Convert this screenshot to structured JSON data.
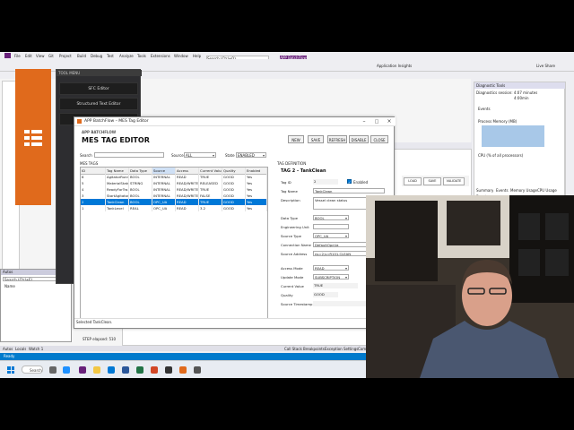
{
  "ide": {
    "menu": [
      "File",
      "Edit",
      "View",
      "Git",
      "Project",
      "Build",
      "Debug",
      "Test",
      "Analyze",
      "Tools",
      "Extensions",
      "Window",
      "Help"
    ],
    "search_placeholder": "Search (Ctrl+Q)",
    "brand_text": "APP BatchFlow",
    "live_share": "Live Share",
    "app_insights": "Application Insights",
    "designer_headers": [
      "Description",
      "Revision",
      "Status"
    ],
    "selected_label": "SELECTED",
    "autos_title": "Autos",
    "autos_search": "Search (Ctrl+E)",
    "autos_col": "Name",
    "bottom_tabs": [
      "Autos",
      "Locals",
      "Watch 1"
    ],
    "bottom_tabs_right": [
      "Call Stack",
      "Breakpoints",
      "Exception Settings",
      "Command Window",
      "Immediate Window",
      "Output"
    ],
    "status": "Ready",
    "step_elapsed": "STEP elapsed: 510"
  },
  "sfc_menu": {
    "title": "TOOL MENU",
    "items": [
      "SFC Editor",
      "Structured Text Editor"
    ]
  },
  "diagnostics": {
    "title": "Diagnostic Tools",
    "session": "Diagnostics session: 4:07 minutes",
    "timeline": "4:00min",
    "events": "Events",
    "process_memory": "Process Memory (MB)",
    "cpu": "CPU (% of all processors)",
    "tabs": [
      "Summary",
      "Events",
      "Memory Usage",
      "CPU Usage"
    ],
    "events2": "Events",
    "show_events": "Show Events (0 of 0)",
    "memory_usage": "Memory Usage",
    "take_snapshot": "Take Snapshot"
  },
  "background_panel": {
    "buttons": [
      "LOAD",
      "SAVE",
      "VALIDATE"
    ],
    "element_label": "SFC ELEMENT",
    "step_label": "STEP",
    "step_value": "S10",
    "num_value": "20",
    "design_label": "DESIGN",
    "start_label": "START"
  },
  "mes": {
    "window_title": "APP BatchFlow – MES Tag Editor",
    "app_label": "APP BATCHFLOW",
    "heading": "MES TAG EDITOR",
    "buttons": [
      "NEW",
      "SAVE",
      "REFRESH",
      "DISABLE",
      "CLOSE"
    ],
    "search_label": "Search",
    "source_label": "Source",
    "source_value": "ALL",
    "state_label": "State",
    "state_value": "ENABLED",
    "tags_label": "MES TAGS",
    "columns": [
      "ID",
      "Tag Name",
      "Data Type",
      "Source",
      "Access",
      "Current Value",
      "Quality",
      "Enabled"
    ],
    "rows": [
      [
        "6",
        "AgitatorRunn...",
        "BOOL",
        "INTERNAL",
        "READ",
        "TRUE",
        "GOOD",
        "Yes"
      ],
      [
        "5",
        "MaterialStatus",
        "STRING",
        "INTERNAL",
        "READ/WRITE",
        "RELEASED",
        "GOOD",
        "Yes"
      ],
      [
        "4",
        "ReadyForTra...",
        "BOOL",
        "INTERNAL",
        "READ/WRITE",
        "TRUE",
        "GOOD",
        "Yes"
      ],
      [
        "3",
        "StartAgitator",
        "BOOL",
        "INTERNAL",
        "READ/WRITE",
        "FALSE",
        "GOOD",
        "Yes"
      ],
      [
        "2",
        "TankClean",
        "BOOL",
        "OPC_UA",
        "READ",
        "TRUE",
        "GOOD",
        "Yes"
      ],
      [
        "1",
        "TankLevel",
        "REAL",
        "OPC_UA",
        "READ",
        "3.2",
        "GOOD",
        "Yes"
      ]
    ],
    "selected_row": 4,
    "definition_label": "TAG DEFINITION",
    "definition_title": "TAG 2 - TankClean",
    "fields": {
      "tag_id_label": "Tag ID",
      "tag_id": "2",
      "enabled_label": "Enabled",
      "tag_name_label": "Tag Name",
      "tag_name": "TankClean",
      "description_label": "Description",
      "description": "Vessel clean status",
      "data_type_label": "Data Type",
      "data_type": "BOOL",
      "eng_unit_label": "Engineering Unit",
      "eng_unit": "",
      "source_type_label": "Source Type",
      "source_type": "OPC_UA",
      "connection_label": "Connection Name",
      "connection": "DefaultOpcUa",
      "address_label": "Source Address",
      "address": "ns=2;s=R101.CLEAN",
      "access_label": "Access Mode",
      "access": "READ",
      "update_label": "Update Mode",
      "update": "SUBSCRIPTION",
      "current_label": "Current Value",
      "current": "TRUE",
      "quality_label": "Quality",
      "quality": "GOOD",
      "timestamp_label": "Source Timestamp",
      "timestamp": ""
    },
    "status": "Selected TankClean."
  },
  "taskbar": {
    "search": "Search"
  },
  "colors": {
    "accent_orange": "#e06a1c",
    "vs_purple": "#68217a",
    "selection_blue": "#0078d7",
    "status_blue": "#007acc"
  }
}
